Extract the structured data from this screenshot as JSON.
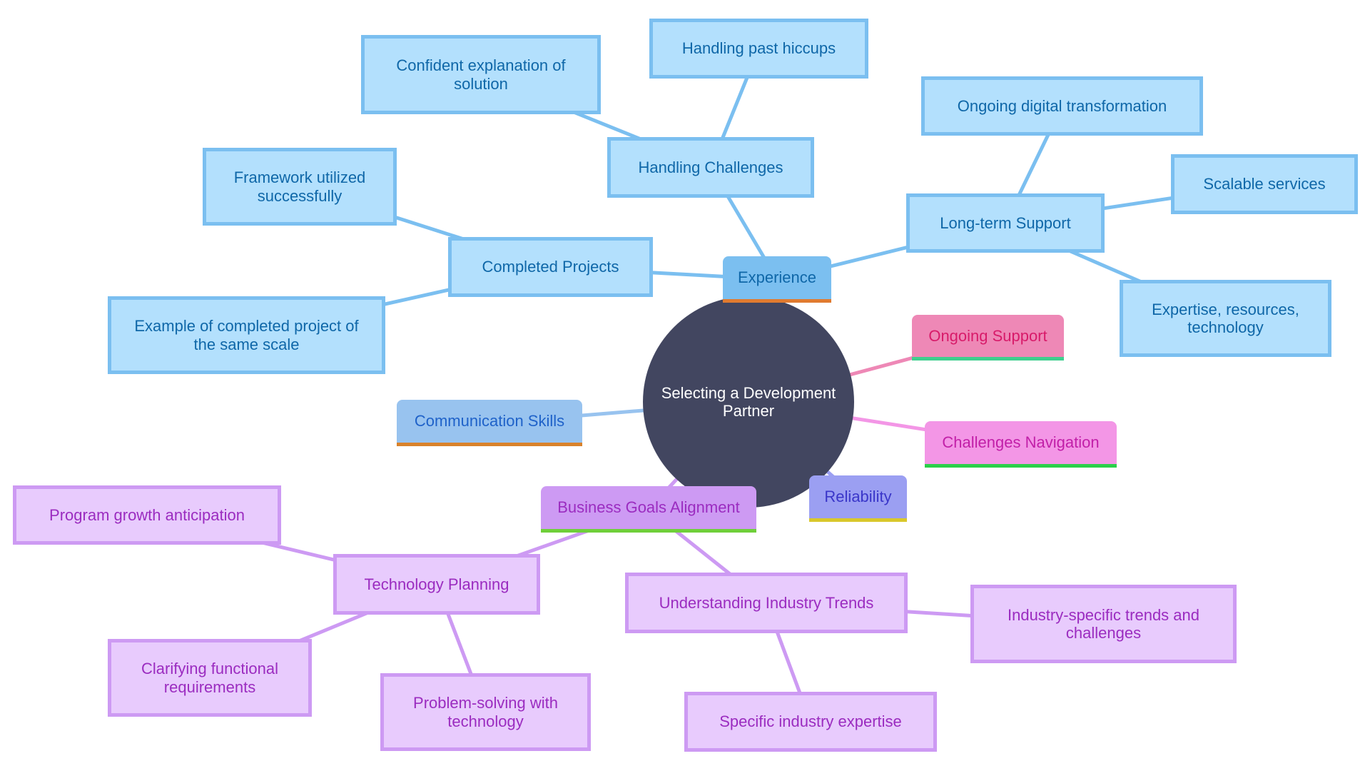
{
  "diagram": {
    "type": "mindmap",
    "root": {
      "id": "root",
      "label": "Selecting a Development Partner"
    },
    "colors": {
      "root_fill": "#424660",
      "root_text": "#ffffff",
      "blue_edge": "#7bbff0",
      "purple_edge": "#cd9af3"
    },
    "nodes": [
      {
        "id": "experience",
        "label": "Experience",
        "parent": "root",
        "kind": "section",
        "fill": "#7bbff0",
        "text": "#0f67a8",
        "bar": "#e07b30",
        "edge": "#7bbff0"
      },
      {
        "id": "handling-challenges",
        "label": "Handling Challenges",
        "parent": "experience",
        "kind": "leaf-blue"
      },
      {
        "id": "handling-past-hiccups",
        "label": "Handling past hiccups",
        "parent": "handling-challenges",
        "kind": "leaf-blue"
      },
      {
        "id": "confident-explanation",
        "label": "Confident explanation of solution",
        "parent": "handling-challenges",
        "kind": "leaf-blue"
      },
      {
        "id": "completed-projects",
        "label": "Completed Projects",
        "parent": "experience",
        "kind": "leaf-blue"
      },
      {
        "id": "framework-utilized",
        "label": "Framework utilized successfully",
        "parent": "completed-projects",
        "kind": "leaf-blue"
      },
      {
        "id": "example-completed",
        "label": "Example of completed project of the same scale",
        "parent": "completed-projects",
        "kind": "leaf-blue"
      },
      {
        "id": "long-term-support",
        "label": "Long-term Support",
        "parent": "experience",
        "kind": "leaf-blue"
      },
      {
        "id": "ongoing-digital",
        "label": "Ongoing digital transformation",
        "parent": "long-term-support",
        "kind": "leaf-blue"
      },
      {
        "id": "scalable-services",
        "label": "Scalable services",
        "parent": "long-term-support",
        "kind": "leaf-blue"
      },
      {
        "id": "expertise-resources",
        "label": "Expertise, resources, technology",
        "parent": "long-term-support",
        "kind": "leaf-blue"
      },
      {
        "id": "ongoing-support",
        "label": "Ongoing Support",
        "parent": "root",
        "kind": "section",
        "fill": "#ee88b6",
        "text": "#d81b6a",
        "bar": "#3ecf8e",
        "edge": "#ee88b6"
      },
      {
        "id": "challenges-navigation",
        "label": "Challenges Navigation",
        "parent": "root",
        "kind": "section",
        "fill": "#f396e6",
        "text": "#c21fa8",
        "bar": "#2bcf4a",
        "edge": "#f396e6"
      },
      {
        "id": "reliability",
        "label": "Reliability",
        "parent": "root",
        "kind": "section",
        "fill": "#9b9ff2",
        "text": "#3a36c9",
        "bar": "#d9c82a",
        "edge": "#9b9ff2"
      },
      {
        "id": "communication-skills",
        "label": "Communication Skills",
        "parent": "root",
        "kind": "section",
        "fill": "#98c3ef",
        "text": "#1f62c9",
        "bar": "#d9822b",
        "edge": "#98c3ef"
      },
      {
        "id": "business-goals",
        "label": "Business Goals Alignment",
        "parent": "root",
        "kind": "section",
        "fill": "#cd9af3",
        "text": "#9b2cc0",
        "bar": "#6fcf3a",
        "edge": "#cd9af3"
      },
      {
        "id": "technology-planning",
        "label": "Technology Planning",
        "parent": "business-goals",
        "kind": "leaf-purple"
      },
      {
        "id": "program-growth",
        "label": "Program growth anticipation",
        "parent": "technology-planning",
        "kind": "leaf-purple"
      },
      {
        "id": "clarifying-requirements",
        "label": "Clarifying functional requirements",
        "parent": "technology-planning",
        "kind": "leaf-purple"
      },
      {
        "id": "problem-solving",
        "label": "Problem-solving with technology",
        "parent": "technology-planning",
        "kind": "leaf-purple"
      },
      {
        "id": "industry-trends",
        "label": "Understanding Industry Trends",
        "parent": "business-goals",
        "kind": "leaf-purple"
      },
      {
        "id": "industry-specific",
        "label": "Industry-specific trends and challenges",
        "parent": "industry-trends",
        "kind": "leaf-purple"
      },
      {
        "id": "specific-expertise",
        "label": "Specific industry expertise",
        "parent": "industry-trends",
        "kind": "leaf-purple"
      }
    ]
  }
}
